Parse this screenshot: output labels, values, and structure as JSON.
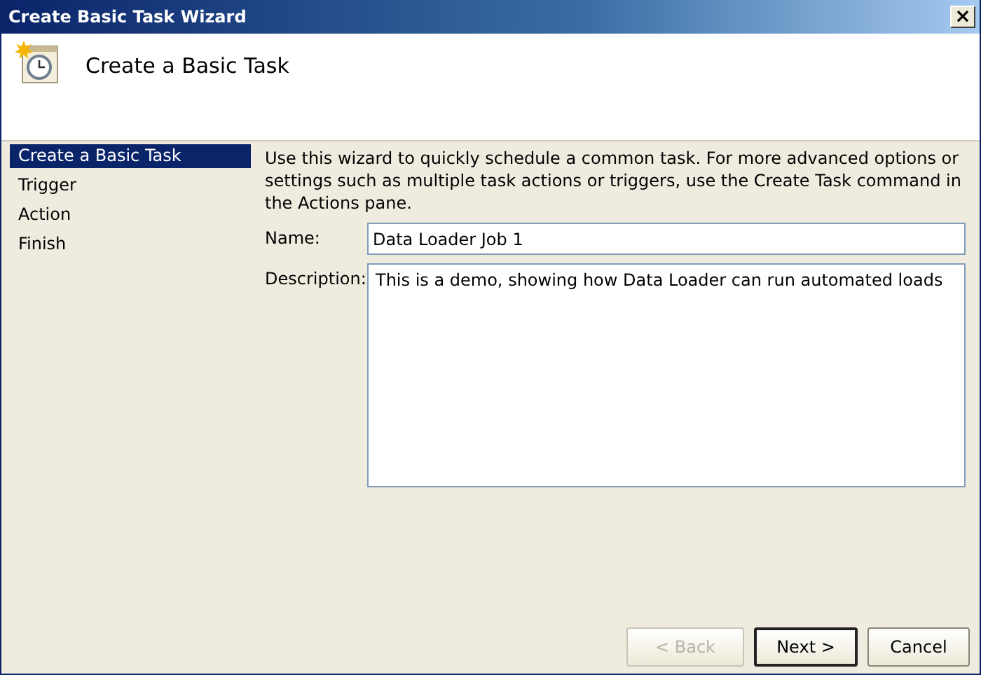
{
  "window": {
    "title": "Create Basic Task Wizard",
    "close": "×"
  },
  "header": {
    "title": "Create a Basic Task"
  },
  "sidebar": {
    "items": [
      {
        "label": "Create a Basic Task",
        "selected": true
      },
      {
        "label": "Trigger",
        "selected": false
      },
      {
        "label": "Action",
        "selected": false
      },
      {
        "label": "Finish",
        "selected": false
      }
    ]
  },
  "intro": "Use this wizard to quickly schedule a common task.  For more advanced options or settings such as multiple task actions or triggers, use the Create Task command in the Actions pane.",
  "fields": [
    {
      "label": "Name:",
      "kind": "line",
      "value": "Data Loader Job 1"
    },
    {
      "label": "Description:",
      "kind": "area",
      "value": "This is a demo, showing how Data Loader can run automated loads"
    }
  ],
  "buttons": [
    {
      "label": "< Back",
      "disabled": true,
      "default": false
    },
    {
      "label": "Next >",
      "disabled": false,
      "default": true
    },
    {
      "label": "Cancel",
      "disabled": false,
      "default": false
    }
  ]
}
